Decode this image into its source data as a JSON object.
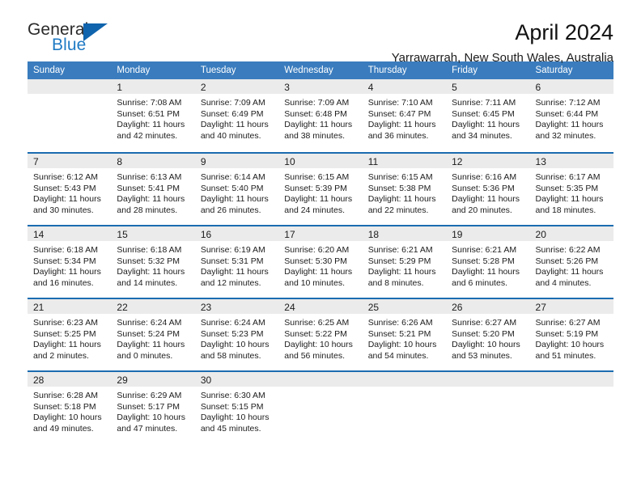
{
  "logo": {
    "word_top": "General",
    "word_bottom": "Blue",
    "triangle_color": "#1064ad",
    "blue_color": "#1f7ac4"
  },
  "header": {
    "title": "April 2024",
    "subtitle": "Yarrawarrah, New South Wales, Australia"
  },
  "theme": {
    "header_bg": "#3a7cbe",
    "week_divider": "#1b6cb0",
    "daynum_band": "#ebebeb"
  },
  "weekday_headers": [
    "Sunday",
    "Monday",
    "Tuesday",
    "Wednesday",
    "Thursday",
    "Friday",
    "Saturday"
  ],
  "weeks": [
    [
      {
        "day": "",
        "sunrise": "",
        "sunset": "",
        "daylight_1": "",
        "daylight_2": ""
      },
      {
        "day": "1",
        "sunrise": "Sunrise: 7:08 AM",
        "sunset": "Sunset: 6:51 PM",
        "daylight_1": "Daylight: 11 hours",
        "daylight_2": "and 42 minutes."
      },
      {
        "day": "2",
        "sunrise": "Sunrise: 7:09 AM",
        "sunset": "Sunset: 6:49 PM",
        "daylight_1": "Daylight: 11 hours",
        "daylight_2": "and 40 minutes."
      },
      {
        "day": "3",
        "sunrise": "Sunrise: 7:09 AM",
        "sunset": "Sunset: 6:48 PM",
        "daylight_1": "Daylight: 11 hours",
        "daylight_2": "and 38 minutes."
      },
      {
        "day": "4",
        "sunrise": "Sunrise: 7:10 AM",
        "sunset": "Sunset: 6:47 PM",
        "daylight_1": "Daylight: 11 hours",
        "daylight_2": "and 36 minutes."
      },
      {
        "day": "5",
        "sunrise": "Sunrise: 7:11 AM",
        "sunset": "Sunset: 6:45 PM",
        "daylight_1": "Daylight: 11 hours",
        "daylight_2": "and 34 minutes."
      },
      {
        "day": "6",
        "sunrise": "Sunrise: 7:12 AM",
        "sunset": "Sunset: 6:44 PM",
        "daylight_1": "Daylight: 11 hours",
        "daylight_2": "and 32 minutes."
      }
    ],
    [
      {
        "day": "7",
        "sunrise": "Sunrise: 6:12 AM",
        "sunset": "Sunset: 5:43 PM",
        "daylight_1": "Daylight: 11 hours",
        "daylight_2": "and 30 minutes."
      },
      {
        "day": "8",
        "sunrise": "Sunrise: 6:13 AM",
        "sunset": "Sunset: 5:41 PM",
        "daylight_1": "Daylight: 11 hours",
        "daylight_2": "and 28 minutes."
      },
      {
        "day": "9",
        "sunrise": "Sunrise: 6:14 AM",
        "sunset": "Sunset: 5:40 PM",
        "daylight_1": "Daylight: 11 hours",
        "daylight_2": "and 26 minutes."
      },
      {
        "day": "10",
        "sunrise": "Sunrise: 6:15 AM",
        "sunset": "Sunset: 5:39 PM",
        "daylight_1": "Daylight: 11 hours",
        "daylight_2": "and 24 minutes."
      },
      {
        "day": "11",
        "sunrise": "Sunrise: 6:15 AM",
        "sunset": "Sunset: 5:38 PM",
        "daylight_1": "Daylight: 11 hours",
        "daylight_2": "and 22 minutes."
      },
      {
        "day": "12",
        "sunrise": "Sunrise: 6:16 AM",
        "sunset": "Sunset: 5:36 PM",
        "daylight_1": "Daylight: 11 hours",
        "daylight_2": "and 20 minutes."
      },
      {
        "day": "13",
        "sunrise": "Sunrise: 6:17 AM",
        "sunset": "Sunset: 5:35 PM",
        "daylight_1": "Daylight: 11 hours",
        "daylight_2": "and 18 minutes."
      }
    ],
    [
      {
        "day": "14",
        "sunrise": "Sunrise: 6:18 AM",
        "sunset": "Sunset: 5:34 PM",
        "daylight_1": "Daylight: 11 hours",
        "daylight_2": "and 16 minutes."
      },
      {
        "day": "15",
        "sunrise": "Sunrise: 6:18 AM",
        "sunset": "Sunset: 5:32 PM",
        "daylight_1": "Daylight: 11 hours",
        "daylight_2": "and 14 minutes."
      },
      {
        "day": "16",
        "sunrise": "Sunrise: 6:19 AM",
        "sunset": "Sunset: 5:31 PM",
        "daylight_1": "Daylight: 11 hours",
        "daylight_2": "and 12 minutes."
      },
      {
        "day": "17",
        "sunrise": "Sunrise: 6:20 AM",
        "sunset": "Sunset: 5:30 PM",
        "daylight_1": "Daylight: 11 hours",
        "daylight_2": "and 10 minutes."
      },
      {
        "day": "18",
        "sunrise": "Sunrise: 6:21 AM",
        "sunset": "Sunset: 5:29 PM",
        "daylight_1": "Daylight: 11 hours",
        "daylight_2": "and 8 minutes."
      },
      {
        "day": "19",
        "sunrise": "Sunrise: 6:21 AM",
        "sunset": "Sunset: 5:28 PM",
        "daylight_1": "Daylight: 11 hours",
        "daylight_2": "and 6 minutes."
      },
      {
        "day": "20",
        "sunrise": "Sunrise: 6:22 AM",
        "sunset": "Sunset: 5:26 PM",
        "daylight_1": "Daylight: 11 hours",
        "daylight_2": "and 4 minutes."
      }
    ],
    [
      {
        "day": "21",
        "sunrise": "Sunrise: 6:23 AM",
        "sunset": "Sunset: 5:25 PM",
        "daylight_1": "Daylight: 11 hours",
        "daylight_2": "and 2 minutes."
      },
      {
        "day": "22",
        "sunrise": "Sunrise: 6:24 AM",
        "sunset": "Sunset: 5:24 PM",
        "daylight_1": "Daylight: 11 hours",
        "daylight_2": "and 0 minutes."
      },
      {
        "day": "23",
        "sunrise": "Sunrise: 6:24 AM",
        "sunset": "Sunset: 5:23 PM",
        "daylight_1": "Daylight: 10 hours",
        "daylight_2": "and 58 minutes."
      },
      {
        "day": "24",
        "sunrise": "Sunrise: 6:25 AM",
        "sunset": "Sunset: 5:22 PM",
        "daylight_1": "Daylight: 10 hours",
        "daylight_2": "and 56 minutes."
      },
      {
        "day": "25",
        "sunrise": "Sunrise: 6:26 AM",
        "sunset": "Sunset: 5:21 PM",
        "daylight_1": "Daylight: 10 hours",
        "daylight_2": "and 54 minutes."
      },
      {
        "day": "26",
        "sunrise": "Sunrise: 6:27 AM",
        "sunset": "Sunset: 5:20 PM",
        "daylight_1": "Daylight: 10 hours",
        "daylight_2": "and 53 minutes."
      },
      {
        "day": "27",
        "sunrise": "Sunrise: 6:27 AM",
        "sunset": "Sunset: 5:19 PM",
        "daylight_1": "Daylight: 10 hours",
        "daylight_2": "and 51 minutes."
      }
    ],
    [
      {
        "day": "28",
        "sunrise": "Sunrise: 6:28 AM",
        "sunset": "Sunset: 5:18 PM",
        "daylight_1": "Daylight: 10 hours",
        "daylight_2": "and 49 minutes."
      },
      {
        "day": "29",
        "sunrise": "Sunrise: 6:29 AM",
        "sunset": "Sunset: 5:17 PM",
        "daylight_1": "Daylight: 10 hours",
        "daylight_2": "and 47 minutes."
      },
      {
        "day": "30",
        "sunrise": "Sunrise: 6:30 AM",
        "sunset": "Sunset: 5:15 PM",
        "daylight_1": "Daylight: 10 hours",
        "daylight_2": "and 45 minutes."
      },
      {
        "day": "",
        "sunrise": "",
        "sunset": "",
        "daylight_1": "",
        "daylight_2": ""
      },
      {
        "day": "",
        "sunrise": "",
        "sunset": "",
        "daylight_1": "",
        "daylight_2": ""
      },
      {
        "day": "",
        "sunrise": "",
        "sunset": "",
        "daylight_1": "",
        "daylight_2": ""
      },
      {
        "day": "",
        "sunrise": "",
        "sunset": "",
        "daylight_1": "",
        "daylight_2": ""
      }
    ]
  ]
}
